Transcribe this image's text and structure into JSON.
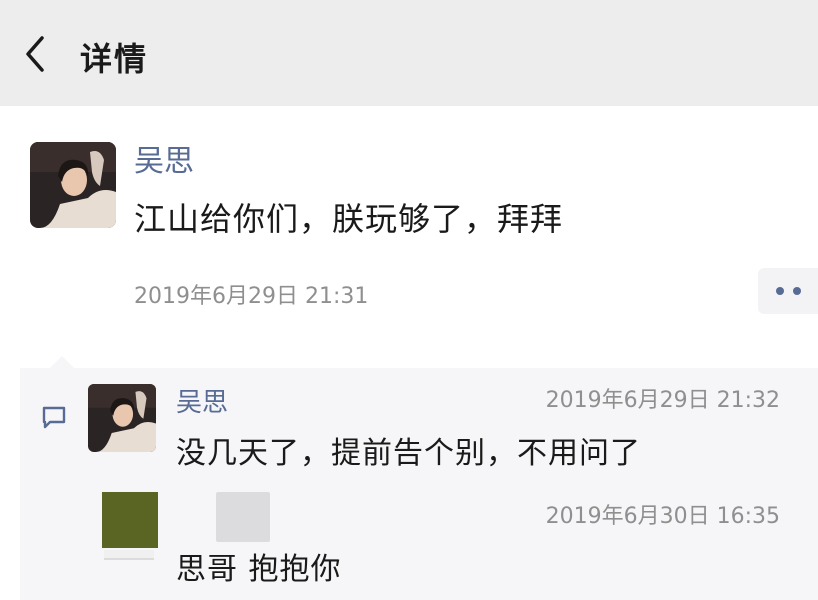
{
  "header": {
    "title": "详情",
    "back_icon": "chevron-left-icon"
  },
  "post": {
    "author": "吴思",
    "content": "江山给你们，朕玩够了，拜拜",
    "time": "2019年6月29日 21:31",
    "more_icon": "more-dots-icon"
  },
  "comments": [
    {
      "author": "吴思",
      "time": "2019年6月29日 21:32",
      "text": "没几天了，提前告个别，不用问了"
    },
    {
      "author": "",
      "time": "2019年6月30日 16:35",
      "text": "思哥 抱抱你"
    }
  ],
  "colors": {
    "link": "#576b95",
    "header_bg": "#ededed",
    "comment_bg": "#f6f6f8",
    "time": "#8f8f8f"
  }
}
